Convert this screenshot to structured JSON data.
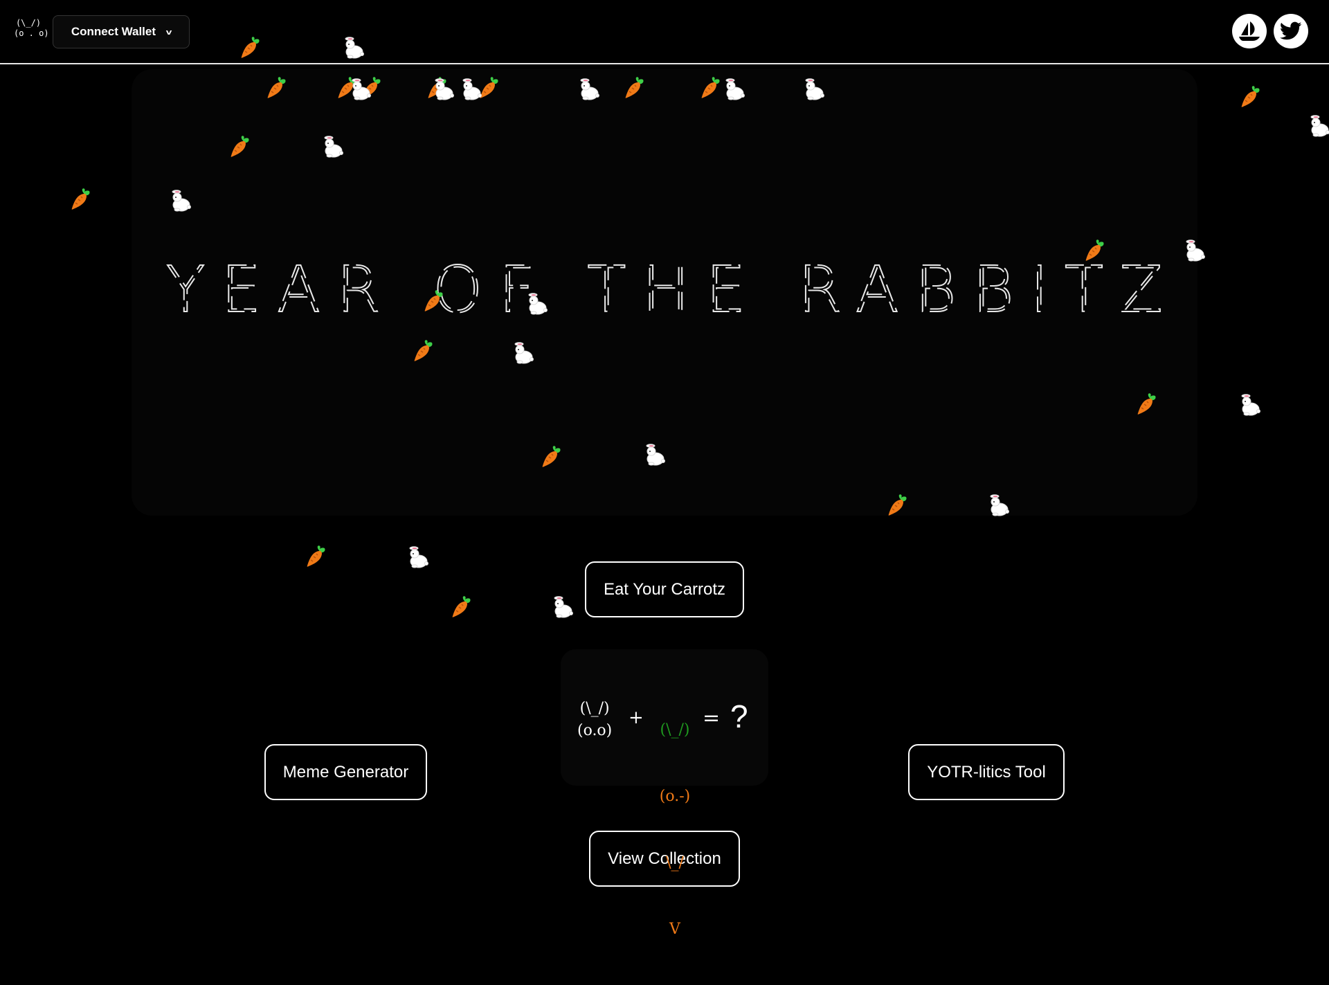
{
  "header": {
    "logo_line1": "(\\_/)",
    "logo_line2": "(o . o)",
    "wallet_button": "Connect Wallet",
    "wallet_chevron": "v",
    "social": [
      "opensea-icon",
      "twitter-icon"
    ]
  },
  "hero": {
    "title": "YEAR OF THE RABBITZ"
  },
  "buttons": {
    "eat": "Eat Your Carrotz",
    "meme": "Meme Generator",
    "yotr": "YOTR-litics Tool",
    "view": "View Collection"
  },
  "equation": {
    "rabbit_line1": "(\\_/)",
    "rabbit_line2": "(o.o)",
    "plus": "+",
    "carrot_ears": "(\\_/)",
    "carrot_face": "(o.-)",
    "carrot_body": "\\_/",
    "carrot_tip": "V",
    "equals": "=",
    "question": "?"
  },
  "colors": {
    "background": "#000000",
    "carrot_orange": "#f07a17",
    "leaf_green": "#3ecf48",
    "ascii_green": "#1f9a1f"
  },
  "decorations": [
    "carrot-icon",
    "rabbit-icon"
  ]
}
